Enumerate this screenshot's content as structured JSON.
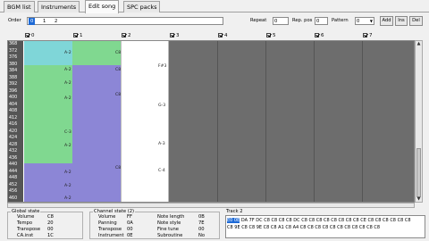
{
  "tabs": [
    {
      "label": "BGM list"
    },
    {
      "label": "Instruments"
    },
    {
      "label": "Edit song"
    },
    {
      "label": "SPC packs"
    }
  ],
  "order": {
    "label": "Order",
    "items": [
      "0",
      "1",
      "2"
    ],
    "selected": "0"
  },
  "repeat": {
    "label": "Repeat",
    "value": "0"
  },
  "rep_pos": {
    "label": "Rep. pos",
    "value": "0"
  },
  "pattern": {
    "label": "Pattern",
    "value": "0"
  },
  "buttons": {
    "add": "Add",
    "ins": "Ins",
    "del": "Del"
  },
  "channels": [
    "0",
    "1",
    "2",
    "3",
    "4",
    "5",
    "6",
    "7"
  ],
  "rows": [
    "368",
    "372",
    "376",
    "380",
    "384",
    "388",
    "392",
    "396",
    "400",
    "404",
    "408",
    "412",
    "416",
    "420",
    "424",
    "428",
    "432",
    "436",
    "440",
    "444",
    "448",
    "452",
    "456",
    "460",
    "464"
  ],
  "notes": {
    "ch0": [
      "A-2",
      "A-2",
      "A-2",
      "A-2",
      "C-3",
      "A-2",
      "A-2",
      "A-2",
      "A-2"
    ],
    "ch1": [
      "C8",
      "C8",
      "C8",
      "C8"
    ],
    "ch2": [
      "F#3",
      "G-3",
      "A-3",
      "C-4"
    ]
  },
  "global_state": {
    "title": "Global state",
    "volume_label": "Volume",
    "volume": "C8",
    "tempo_label": "Tempo",
    "tempo": "20",
    "transpose_label": "Transpose",
    "transpose": "00",
    "cajnst_label": "CA.inst",
    "cajnst": "1C"
  },
  "channel_state": {
    "title": "Channel state (2)",
    "volume_label": "Volume",
    "volume": "FF",
    "panning_label": "Panning",
    "panning": "0A",
    "transpose_label": "Transpose",
    "transpose": "00",
    "instrument_label": "Instrument",
    "instrument": "0E",
    "note_length_label": "Note length",
    "note_length": "0B",
    "note_style_label": "Note style",
    "note_style": "7E",
    "fine_tune_label": "Fine tune",
    "fine_tune": "00",
    "subroutine_label": "Subroutine",
    "subroutine": "No"
  },
  "track": {
    "title": "Track 2",
    "highlight": "E0 0E",
    "line1": " DA 7F DC C8 C8 C8 C8 DC C8 C8 C8 C8 C8 C8 C8 C8 CE C8 C8 C8 C8 C8 C8",
    "line2": "C8 9E C8 C8 9E C8 C8 A1 C8 A4 C8 C8 C8 C8 C8 C8 C8 C8 C8 C8 C8"
  },
  "colors": {
    "cyan": "#7fd6d8",
    "green": "#80d890",
    "purple": "#8c86d6",
    "gray": "#6d6d6d",
    "select": "#1e6ad6"
  }
}
